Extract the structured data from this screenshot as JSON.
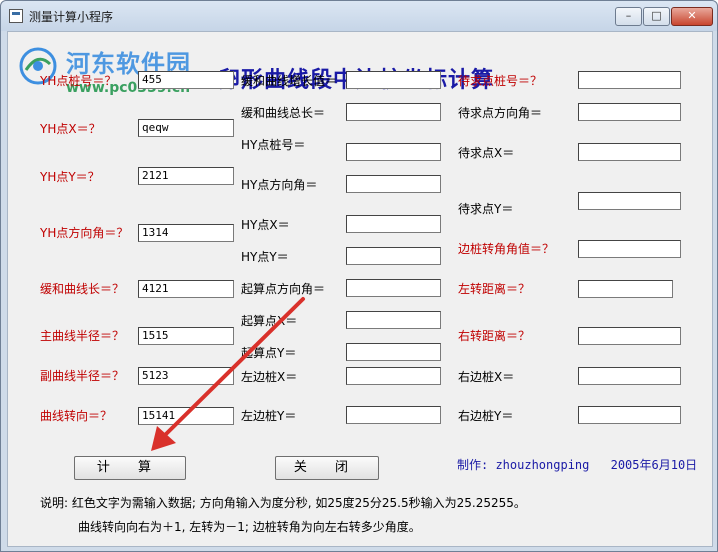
{
  "window": {
    "title": "测量计算小程序",
    "controls": {
      "minimize": "–",
      "maximize": "□",
      "close": "✕"
    }
  },
  "watermark": {
    "name": "河东软件园",
    "url": "www.pc0359.cn"
  },
  "main_title": "卵形曲线段中边桩坐标计算",
  "left_column": [
    {
      "label": "YH点桩号＝？",
      "value": "455"
    },
    {
      "label": "YH点X＝？",
      "value": "qeqw"
    },
    {
      "label": "YH点Y＝？",
      "value": "2121"
    },
    {
      "label": "YH点方向角＝？",
      "value": "1314"
    },
    {
      "label": "缓和曲线长＝？",
      "value": "4121"
    },
    {
      "label": "主曲线半径＝？",
      "value": "1515"
    },
    {
      "label": "副曲线半径＝？",
      "value": "5123"
    },
    {
      "label": "曲线转向＝？",
      "value": "15141"
    }
  ],
  "middle_column": [
    {
      "label": "缓和曲线增长值＝",
      "value": ""
    },
    {
      "label": "缓和曲线总长＝",
      "value": ""
    },
    {
      "label": "HY点桩号＝",
      "value": ""
    },
    {
      "label": "HY点方向角＝",
      "value": ""
    },
    {
      "label": "HY点X＝",
      "value": ""
    },
    {
      "label": "HY点Y＝",
      "value": ""
    },
    {
      "label": "起算点方向角＝",
      "value": ""
    },
    {
      "label": "起算点X＝",
      "value": ""
    },
    {
      "label": "起算点Y＝",
      "value": ""
    },
    {
      "label": "左边桩X＝",
      "value": ""
    },
    {
      "label": "左边桩Y＝",
      "value": ""
    }
  ],
  "right_column": [
    {
      "label": "待求点桩号＝？",
      "value": ""
    },
    {
      "label": "待求点方向角＝",
      "value": ""
    },
    {
      "label": "待求点X＝",
      "value": ""
    },
    {
      "label": "待求点Y＝",
      "value": ""
    },
    {
      "label": "边桩转角角值＝？",
      "value": ""
    },
    {
      "label": "左转距离＝？",
      "value": ""
    },
    {
      "label": "右转距离＝？",
      "value": ""
    },
    {
      "label": "右边桩X＝",
      "value": ""
    },
    {
      "label": "右边桩Y＝",
      "value": ""
    }
  ],
  "buttons": {
    "compute": "计 算",
    "close": "关 闭"
  },
  "credit": {
    "author": "制作: zhouzhongping",
    "date": "2005年6月10日"
  },
  "notes": [
    "说明: 红色文字为需输入数据; 方向角输入为度分秒, 如25度25分25.5秒输入为25.25255。",
    "曲线转向向右为＋1, 左转为－1; 边桩转角为向左右转多少角度。"
  ],
  "colors": {
    "input_label": "#c00000",
    "title": "#1a1aa6",
    "arrow": "#d9312b"
  }
}
